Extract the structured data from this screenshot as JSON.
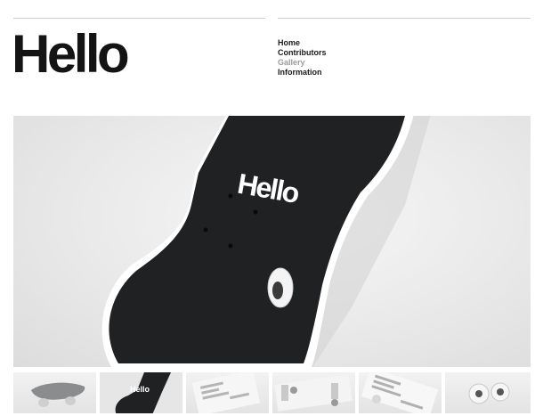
{
  "header": {
    "logo_text": "Hello"
  },
  "nav": {
    "items": [
      {
        "label": "Home",
        "active": false
      },
      {
        "label": "Contributors",
        "active": false
      },
      {
        "label": "Gallery",
        "active": true
      },
      {
        "label": "Information",
        "active": false
      }
    ]
  },
  "hero": {
    "deck_text": "Hello"
  },
  "gallery": {
    "thumbnails": [
      {
        "subject": "skateboard side view"
      },
      {
        "subject": "black deck with logo",
        "active": true
      },
      {
        "subject": "printed deck typography"
      },
      {
        "subject": "deck underside trucks"
      },
      {
        "subject": "printed deck angled"
      },
      {
        "subject": "wheels close-up"
      }
    ]
  },
  "colors": {
    "text": "#1a1a1a",
    "active_nav": "#9a9a9a",
    "rule": "#cfcfcf",
    "deck": "#1f2123"
  }
}
